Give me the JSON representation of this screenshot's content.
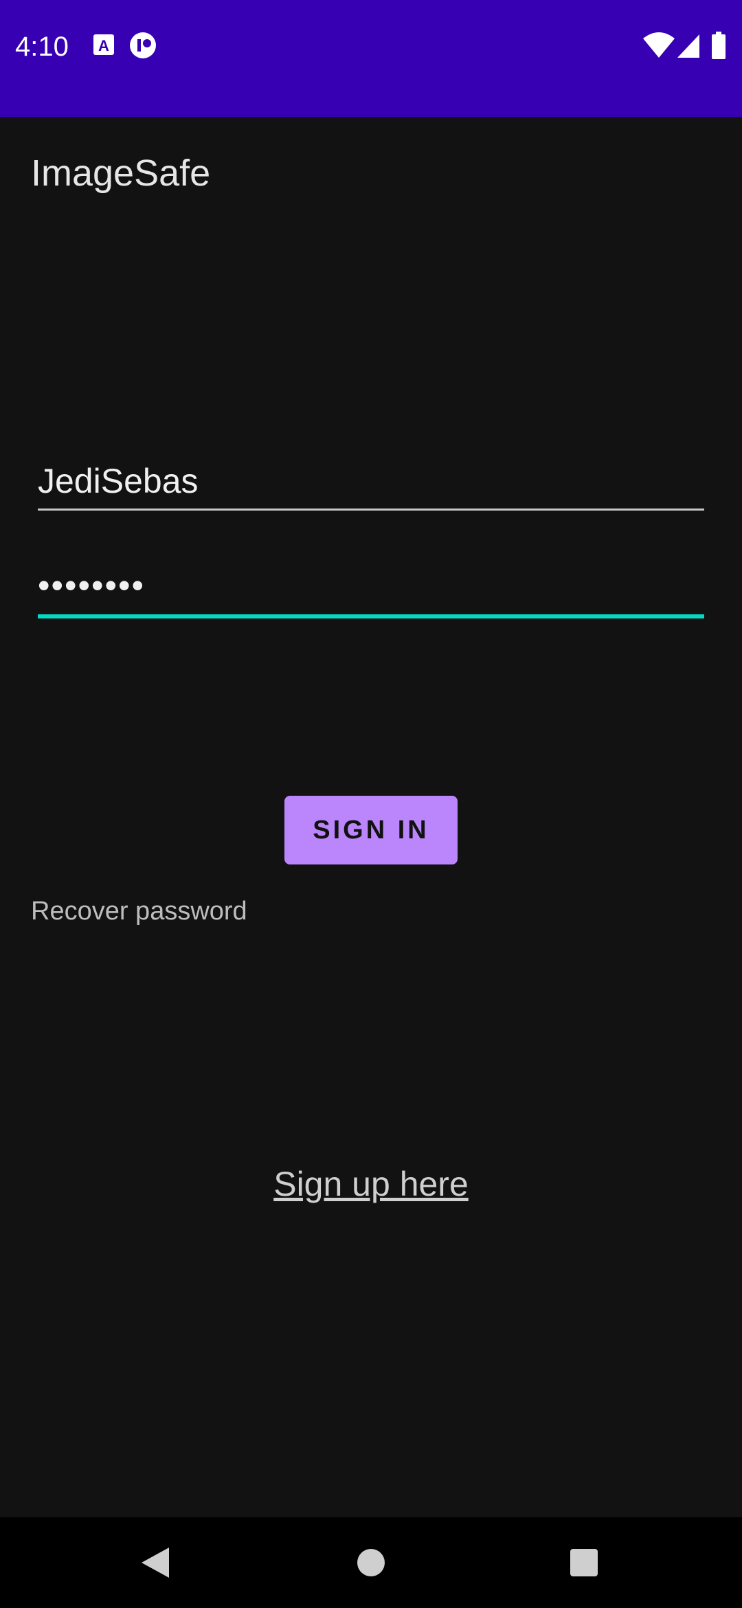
{
  "status_bar": {
    "time": "4:10",
    "left_icons": [
      "keyboard-a-icon",
      "status-circle-icon"
    ],
    "right_icons": [
      "wifi-icon",
      "cell-signal-icon",
      "battery-icon"
    ],
    "background": "#3700B3"
  },
  "app": {
    "title": "ImageSafe"
  },
  "form": {
    "username_value": "JediSebas",
    "password_value": "••••••••",
    "accent_color": "#03DAC5"
  },
  "actions": {
    "sign_in_label": "SIGN IN",
    "sign_in_color": "#BB86FC",
    "recover_label": "Recover password",
    "signup_label": "Sign up here"
  },
  "nav_bar": {
    "buttons": [
      "back-icon",
      "home-icon",
      "recents-icon"
    ]
  }
}
